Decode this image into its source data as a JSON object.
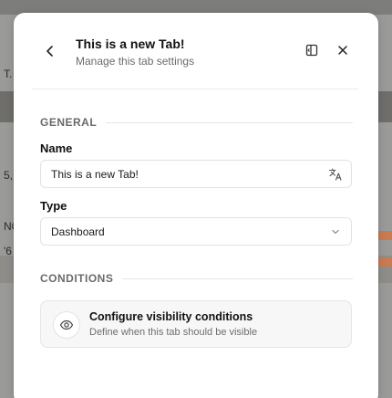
{
  "backdrop": {
    "fragments": [
      "T.",
      "5,",
      "NO",
      "'6"
    ]
  },
  "header": {
    "title": "This is a new Tab!",
    "subtitle": "Manage this tab settings"
  },
  "general": {
    "section_label": "GENERAL",
    "name_label": "Name",
    "name_value": "This is a new Tab!",
    "type_label": "Type",
    "type_value": "Dashboard"
  },
  "conditions": {
    "section_label": "CONDITIONS",
    "card_title": "Configure visibility conditions",
    "card_subtitle": "Define when this tab should be visible"
  },
  "icons": {
    "back": "chevron-left-icon",
    "panel": "panel-left-icon",
    "close": "close-icon",
    "translate": "translate-icon",
    "dropdown": "chevron-down-icon",
    "visibility": "eye-icon"
  }
}
